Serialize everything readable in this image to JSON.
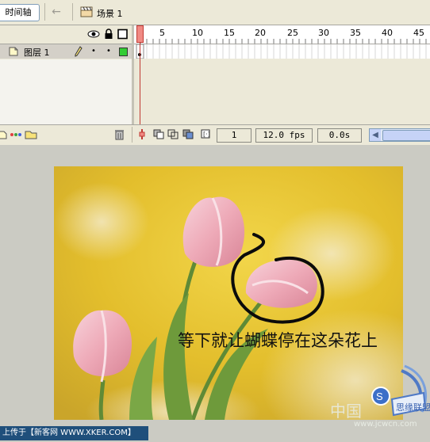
{
  "toolbar": {
    "timeline_tab": "时间轴",
    "scene_label": "场景 1"
  },
  "layers": {
    "row_name": "图层 1"
  },
  "ruler": {
    "marks": [
      "1",
      "5",
      "10",
      "15",
      "20",
      "25",
      "30",
      "35",
      "40",
      "45"
    ]
  },
  "status": {
    "current_frame": "1",
    "frame_rate": "12.0 fps",
    "elapsed": "0.0s"
  },
  "stage": {
    "caption": "等下就让蝴蝶停在这朵花上"
  },
  "footer": {
    "credit": "上传于【新客网 WWW.XKER.COM】",
    "watermark_cn": "中国",
    "watermark_url": "www.jcwcn.com",
    "badge_text": "思缘联盟"
  },
  "colors": {
    "panel_bg": "#ece9d8",
    "playhead": "#f08a84",
    "layer_color": "#33cc33",
    "credit_bg": "#1f4f7b"
  }
}
